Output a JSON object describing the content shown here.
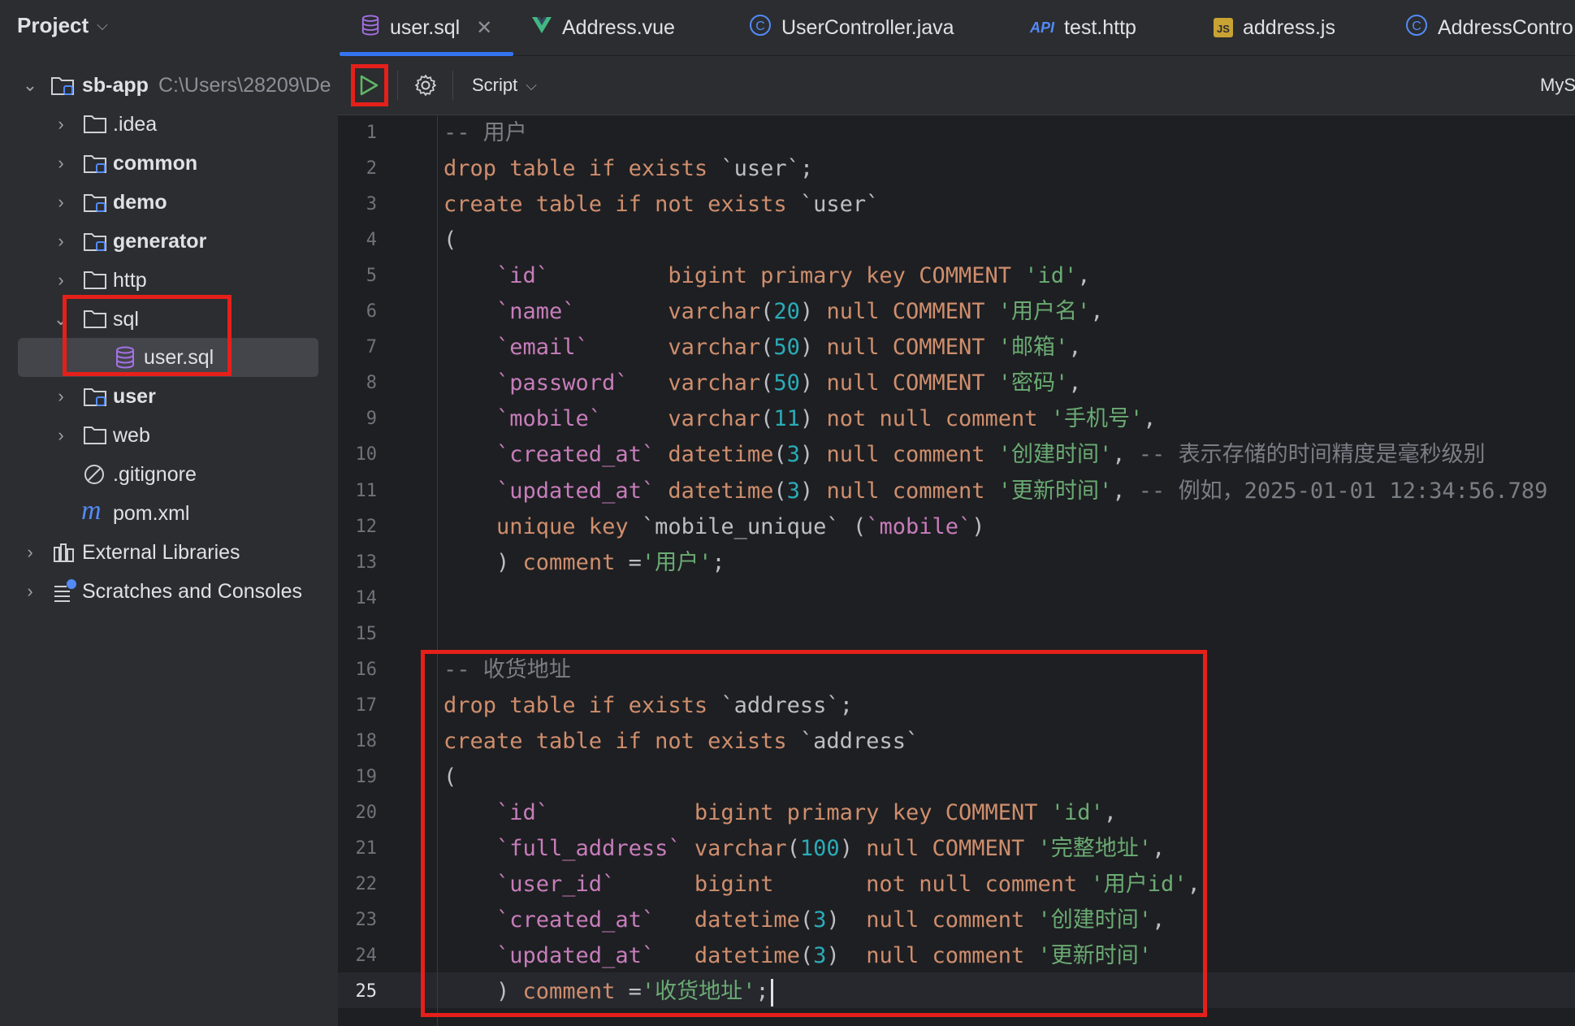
{
  "colors": {
    "sidebar_bg": "#2b2d30",
    "editor_bg": "#1e1f22",
    "keyword": "#cf8e6d",
    "string": "#6aab73",
    "number": "#2aacb8",
    "comment": "#7a7e85",
    "identifier": "#c77dbb",
    "highlight_red": "#e5201a",
    "run_green": "#5fb865",
    "accent_blue": "#3574f0"
  },
  "sidebar": {
    "title": "Project",
    "root": {
      "label": "sb-app",
      "path": "C:\\Users\\28209\\De"
    },
    "items": [
      {
        "label": ".idea",
        "icon": "folder-icon"
      },
      {
        "label": "common",
        "icon": "module-folder-icon"
      },
      {
        "label": "demo",
        "icon": "module-folder-icon"
      },
      {
        "label": "generator",
        "icon": "module-folder-icon"
      },
      {
        "label": "http",
        "icon": "folder-icon"
      },
      {
        "label": "sql",
        "icon": "folder-icon"
      },
      {
        "label": "user.sql",
        "icon": "database-file-icon"
      },
      {
        "label": "user",
        "icon": "module-folder-icon"
      },
      {
        "label": "web",
        "icon": "folder-icon"
      },
      {
        "label": ".gitignore",
        "icon": "ignore-file-icon"
      },
      {
        "label": "pom.xml",
        "icon": "maven-icon"
      },
      {
        "label": "External Libraries",
        "icon": "libraries-icon"
      },
      {
        "label": "Scratches and Consoles",
        "icon": "scratches-icon"
      }
    ]
  },
  "tabs": [
    {
      "label": "user.sql",
      "icon": "database-file-icon"
    },
    {
      "label": "Address.vue",
      "icon": "vue-icon"
    },
    {
      "label": "UserController.java",
      "icon": "java-class-icon"
    },
    {
      "label": "test.http",
      "icon": "api-icon",
      "icon_text": "API"
    },
    {
      "label": "address.js",
      "icon": "js-icon",
      "icon_text": "JS"
    },
    {
      "label": "AddressContro",
      "icon": "java-class-icon"
    }
  ],
  "toolbar": {
    "script_label": "Script",
    "datasource_label": "MyS"
  },
  "editor": {
    "current_line": 25,
    "line_numbers": [
      "1",
      "2",
      "3",
      "4",
      "5",
      "6",
      "7",
      "8",
      "9",
      "10",
      "11",
      "12",
      "13",
      "14",
      "15",
      "16",
      "17",
      "18",
      "19",
      "20",
      "21",
      "22",
      "23",
      "24",
      "25"
    ],
    "lines": [
      [
        {
          "t": "-- 用户",
          "c": "cmt"
        }
      ],
      [
        {
          "t": "drop table if exists ",
          "c": "kw"
        },
        {
          "t": "`user`",
          "c": "plain"
        },
        {
          "t": ";",
          "c": "plain"
        }
      ],
      [
        {
          "t": "create table if not exists ",
          "c": "kw"
        },
        {
          "t": "`user`",
          "c": "plain"
        }
      ],
      [
        {
          "t": "(",
          "c": "plain"
        }
      ],
      [
        {
          "t": "    `id`         ",
          "c": "ident"
        },
        {
          "t": "bigint primary key COMMENT ",
          "c": "kw"
        },
        {
          "t": "'id'",
          "c": "str"
        },
        {
          "t": ",",
          "c": "plain"
        }
      ],
      [
        {
          "t": "    `name`       ",
          "c": "ident"
        },
        {
          "t": "varchar",
          "c": "kw"
        },
        {
          "t": "(",
          "c": "plain"
        },
        {
          "t": "20",
          "c": "num"
        },
        {
          "t": ") ",
          "c": "plain"
        },
        {
          "t": "null COMMENT ",
          "c": "kw"
        },
        {
          "t": "'用户名'",
          "c": "str"
        },
        {
          "t": ",",
          "c": "plain"
        }
      ],
      [
        {
          "t": "    `email`      ",
          "c": "ident"
        },
        {
          "t": "varchar",
          "c": "kw"
        },
        {
          "t": "(",
          "c": "plain"
        },
        {
          "t": "50",
          "c": "num"
        },
        {
          "t": ") ",
          "c": "plain"
        },
        {
          "t": "null COMMENT ",
          "c": "kw"
        },
        {
          "t": "'邮箱'",
          "c": "str"
        },
        {
          "t": ",",
          "c": "plain"
        }
      ],
      [
        {
          "t": "    `password`   ",
          "c": "ident"
        },
        {
          "t": "varchar",
          "c": "kw"
        },
        {
          "t": "(",
          "c": "plain"
        },
        {
          "t": "50",
          "c": "num"
        },
        {
          "t": ") ",
          "c": "plain"
        },
        {
          "t": "null COMMENT ",
          "c": "kw"
        },
        {
          "t": "'密码'",
          "c": "str"
        },
        {
          "t": ",",
          "c": "plain"
        }
      ],
      [
        {
          "t": "    `mobile`     ",
          "c": "ident"
        },
        {
          "t": "varchar",
          "c": "kw"
        },
        {
          "t": "(",
          "c": "plain"
        },
        {
          "t": "11",
          "c": "num"
        },
        {
          "t": ") ",
          "c": "plain"
        },
        {
          "t": "not null comment ",
          "c": "kw"
        },
        {
          "t": "'手机号'",
          "c": "str"
        },
        {
          "t": ",",
          "c": "plain"
        }
      ],
      [
        {
          "t": "    `created_at` ",
          "c": "ident"
        },
        {
          "t": "datetime",
          "c": "kw"
        },
        {
          "t": "(",
          "c": "plain"
        },
        {
          "t": "3",
          "c": "num"
        },
        {
          "t": ") ",
          "c": "plain"
        },
        {
          "t": "null comment ",
          "c": "kw"
        },
        {
          "t": "'创建时间'",
          "c": "str"
        },
        {
          "t": ", ",
          "c": "plain"
        },
        {
          "t": "-- 表示存储的时间精度是毫秒级别",
          "c": "cmt"
        }
      ],
      [
        {
          "t": "    `updated_at` ",
          "c": "ident"
        },
        {
          "t": "datetime",
          "c": "kw"
        },
        {
          "t": "(",
          "c": "plain"
        },
        {
          "t": "3",
          "c": "num"
        },
        {
          "t": ") ",
          "c": "plain"
        },
        {
          "t": "null comment ",
          "c": "kw"
        },
        {
          "t": "'更新时间'",
          "c": "str"
        },
        {
          "t": ", ",
          "c": "plain"
        },
        {
          "t": "-- 例如，2025-01-01 12:34:56.789",
          "c": "cmt"
        }
      ],
      [
        {
          "t": "    unique key ",
          "c": "kw"
        },
        {
          "t": "`mobile_unique` ",
          "c": "plain"
        },
        {
          "t": "(",
          "c": "plain"
        },
        {
          "t": "`mobile`",
          "c": "ident"
        },
        {
          "t": ")",
          "c": "plain"
        }
      ],
      [
        {
          "t": "    ) ",
          "c": "plain"
        },
        {
          "t": "comment ",
          "c": "kw"
        },
        {
          "t": "=",
          "c": "plain"
        },
        {
          "t": "'用户'",
          "c": "str"
        },
        {
          "t": ";",
          "c": "plain"
        }
      ],
      [],
      [],
      [
        {
          "t": "-- 收货地址",
          "c": "cmt"
        }
      ],
      [
        {
          "t": "drop table if exists ",
          "c": "kw"
        },
        {
          "t": "`address`",
          "c": "plain"
        },
        {
          "t": ";",
          "c": "plain"
        }
      ],
      [
        {
          "t": "create table if not exists ",
          "c": "kw"
        },
        {
          "t": "`address`",
          "c": "plain"
        }
      ],
      [
        {
          "t": "(",
          "c": "plain"
        }
      ],
      [
        {
          "t": "    `id`           ",
          "c": "ident"
        },
        {
          "t": "bigint primary key COMMENT ",
          "c": "kw"
        },
        {
          "t": "'id'",
          "c": "str"
        },
        {
          "t": ",",
          "c": "plain"
        }
      ],
      [
        {
          "t": "    `full_address` ",
          "c": "ident"
        },
        {
          "t": "varchar",
          "c": "kw"
        },
        {
          "t": "(",
          "c": "plain"
        },
        {
          "t": "100",
          "c": "num"
        },
        {
          "t": ") ",
          "c": "plain"
        },
        {
          "t": "null COMMENT ",
          "c": "kw"
        },
        {
          "t": "'完整地址'",
          "c": "str"
        },
        {
          "t": ",",
          "c": "plain"
        }
      ],
      [
        {
          "t": "    `user_id`      ",
          "c": "ident"
        },
        {
          "t": "bigint       not null comment ",
          "c": "kw"
        },
        {
          "t": "'用户id'",
          "c": "str"
        },
        {
          "t": ",",
          "c": "plain"
        }
      ],
      [
        {
          "t": "    `created_at`   ",
          "c": "ident"
        },
        {
          "t": "datetime",
          "c": "kw"
        },
        {
          "t": "(",
          "c": "plain"
        },
        {
          "t": "3",
          "c": "num"
        },
        {
          "t": ")  ",
          "c": "plain"
        },
        {
          "t": "null comment ",
          "c": "kw"
        },
        {
          "t": "'创建时间'",
          "c": "str"
        },
        {
          "t": ",",
          "c": "plain"
        }
      ],
      [
        {
          "t": "    `updated_at`   ",
          "c": "ident"
        },
        {
          "t": "datetime",
          "c": "kw"
        },
        {
          "t": "(",
          "c": "plain"
        },
        {
          "t": "3",
          "c": "num"
        },
        {
          "t": ")  ",
          "c": "plain"
        },
        {
          "t": "null comment ",
          "c": "kw"
        },
        {
          "t": "'更新时间'",
          "c": "str"
        }
      ],
      [
        {
          "t": "    ) ",
          "c": "plain"
        },
        {
          "t": "comment ",
          "c": "kw"
        },
        {
          "t": "=",
          "c": "plain"
        },
        {
          "t": "'收货地址'",
          "c": "str"
        },
        {
          "t": ";",
          "c": "plain"
        }
      ]
    ]
  }
}
